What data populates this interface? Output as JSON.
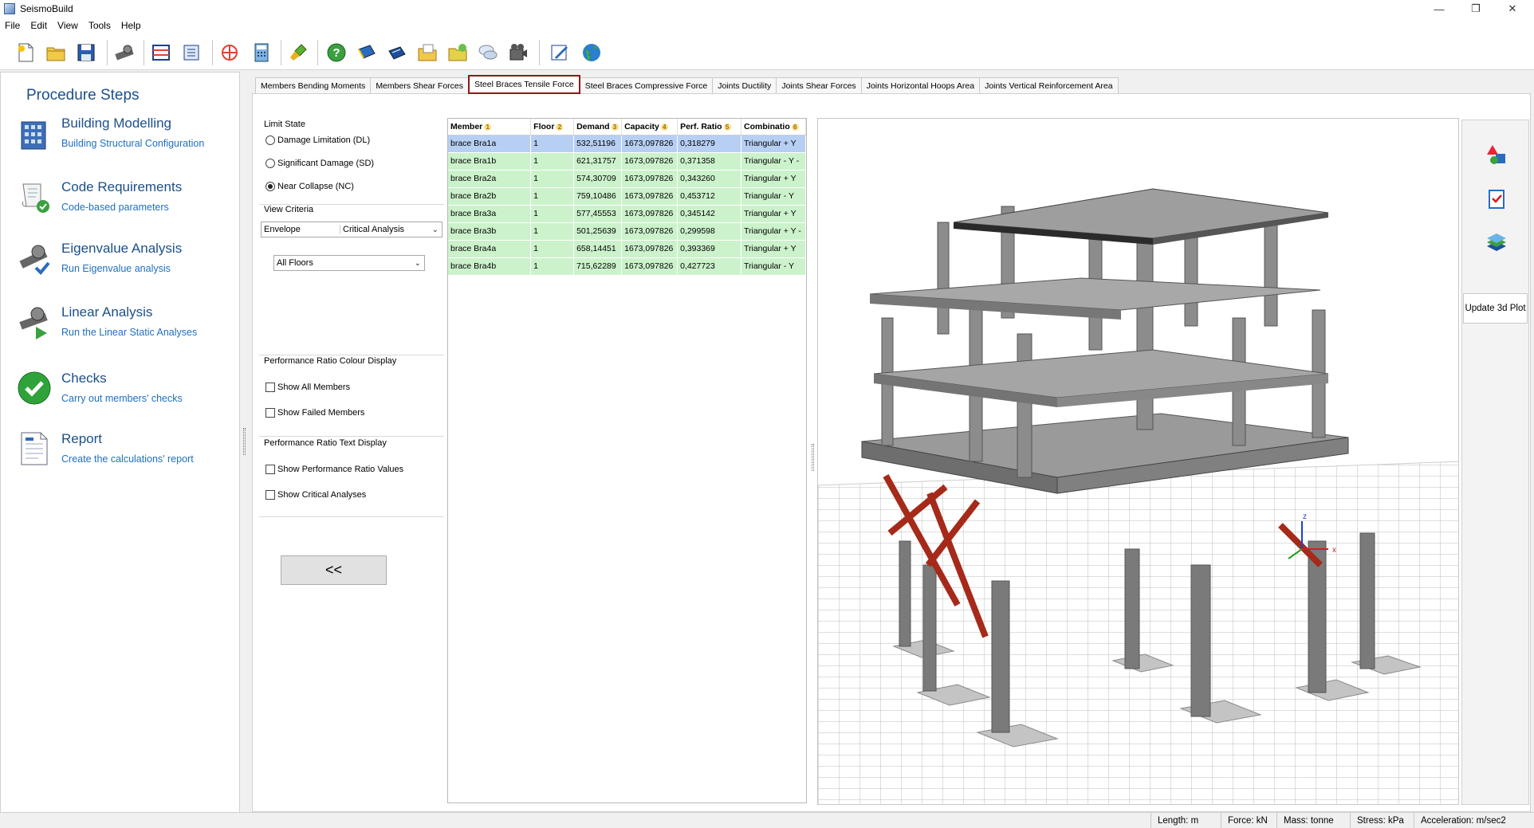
{
  "app": {
    "title": "SeismoBuild"
  },
  "menu": [
    "File",
    "Edit",
    "View",
    "Tools",
    "Help"
  ],
  "procedure": {
    "title": "Procedure Steps",
    "steps": [
      {
        "name": "Building Modelling",
        "desc": "Building Structural Configuration",
        "icon": "building-icon"
      },
      {
        "name": "Code Requirements",
        "desc": "Code-based parameters",
        "icon": "code-scroll-icon"
      },
      {
        "name": "Eigenvalue Analysis",
        "desc": "Run Eigenvalue analysis",
        "icon": "eigenvalue-icon"
      },
      {
        "name": "Linear Analysis",
        "desc": "Run the Linear Static Analyses",
        "icon": "linear-analysis-icon"
      },
      {
        "name": "Checks",
        "desc": "Carry out members' checks",
        "icon": "check-icon"
      },
      {
        "name": "Report",
        "desc": "Create the calculations' report",
        "icon": "report-icon"
      }
    ]
  },
  "tabs": [
    "Members Bending Moments",
    "Members Shear Forces",
    "Steel Braces Tensile Force",
    "Steel Braces Compressive Force",
    "Joints Ductility",
    "Joints Shear Forces",
    "Joints Horizontal Hoops Area",
    "Joints Vertical Reinforcement Area"
  ],
  "active_tab": "Steel Braces Tensile Force",
  "options": {
    "limit_state_header": "Limit State",
    "limit_states": [
      "Damage Limitation (DL)",
      "Significant Damage (SD)",
      "Near Collapse (NC)"
    ],
    "limit_state_selected": "Near Collapse (NC)",
    "view_criteria_header": "View Criteria",
    "view_criteria_left": "Envelope",
    "view_criteria_right": "Critical Analysis",
    "floors": "All Floors",
    "colour_header": "Performance Ratio Colour Display",
    "show_all": "Show All Members",
    "show_failed": "Show Failed Members",
    "text_header": "Performance Ratio Text Display",
    "show_values": "Show Performance Ratio Values",
    "show_critical": "Show Critical Analyses",
    "collapse_label": "<<"
  },
  "table": {
    "columns": [
      {
        "label": "Member",
        "sort": "1"
      },
      {
        "label": "Floor",
        "sort": "2"
      },
      {
        "label": "Demand",
        "sort": "3"
      },
      {
        "label": "Capacity",
        "sort": "4"
      },
      {
        "label": "Perf. Ratio",
        "sort": "5"
      },
      {
        "label": "Combinatio",
        "sort": "6"
      }
    ],
    "rows": [
      [
        "brace Bra1a",
        "1",
        "532,51196",
        "1673,097826",
        "0,318279",
        "Triangular  + Y"
      ],
      [
        "brace Bra1b",
        "1",
        "621,31757",
        "1673,097826",
        "0,371358",
        "Triangular  - Y -"
      ],
      [
        "brace Bra2a",
        "1",
        "574,30709",
        "1673,097826",
        "0,343260",
        "Triangular  + Y"
      ],
      [
        "brace Bra2b",
        "1",
        "759,10486",
        "1673,097826",
        "0,453712",
        "Triangular  - Y"
      ],
      [
        "brace Bra3a",
        "1",
        "577,45553",
        "1673,097826",
        "0,345142",
        "Triangular  + Y"
      ],
      [
        "brace Bra3b",
        "1",
        "501,25639",
        "1673,097826",
        "0,299598",
        "Triangular  + Y -"
      ],
      [
        "brace Bra4a",
        "1",
        "658,14451",
        "1673,097826",
        "0,393369",
        "Triangular  + Y"
      ],
      [
        "brace Bra4b",
        "1",
        "715,62289",
        "1673,097826",
        "0,427723",
        "Triangular  - Y"
      ]
    ],
    "selected_row": 0
  },
  "viewport": {
    "axis_z": "z",
    "axis_x": "x"
  },
  "right_tools": {
    "update_label": "Update 3d Plot"
  },
  "status": {
    "length": "Length: m",
    "force": "Force: kN",
    "mass": "Mass: tonne",
    "stress": "Stress: kPa",
    "acceleration": "Acceleration: m/sec2"
  },
  "colors": {
    "accent": "#1b4f8a",
    "link": "#1f6fc1",
    "row_ok": "#ccf2cc",
    "row_selected": "#b7cff3",
    "active_tab_border": "#8b1a1a",
    "brace": "#a52a1a"
  }
}
